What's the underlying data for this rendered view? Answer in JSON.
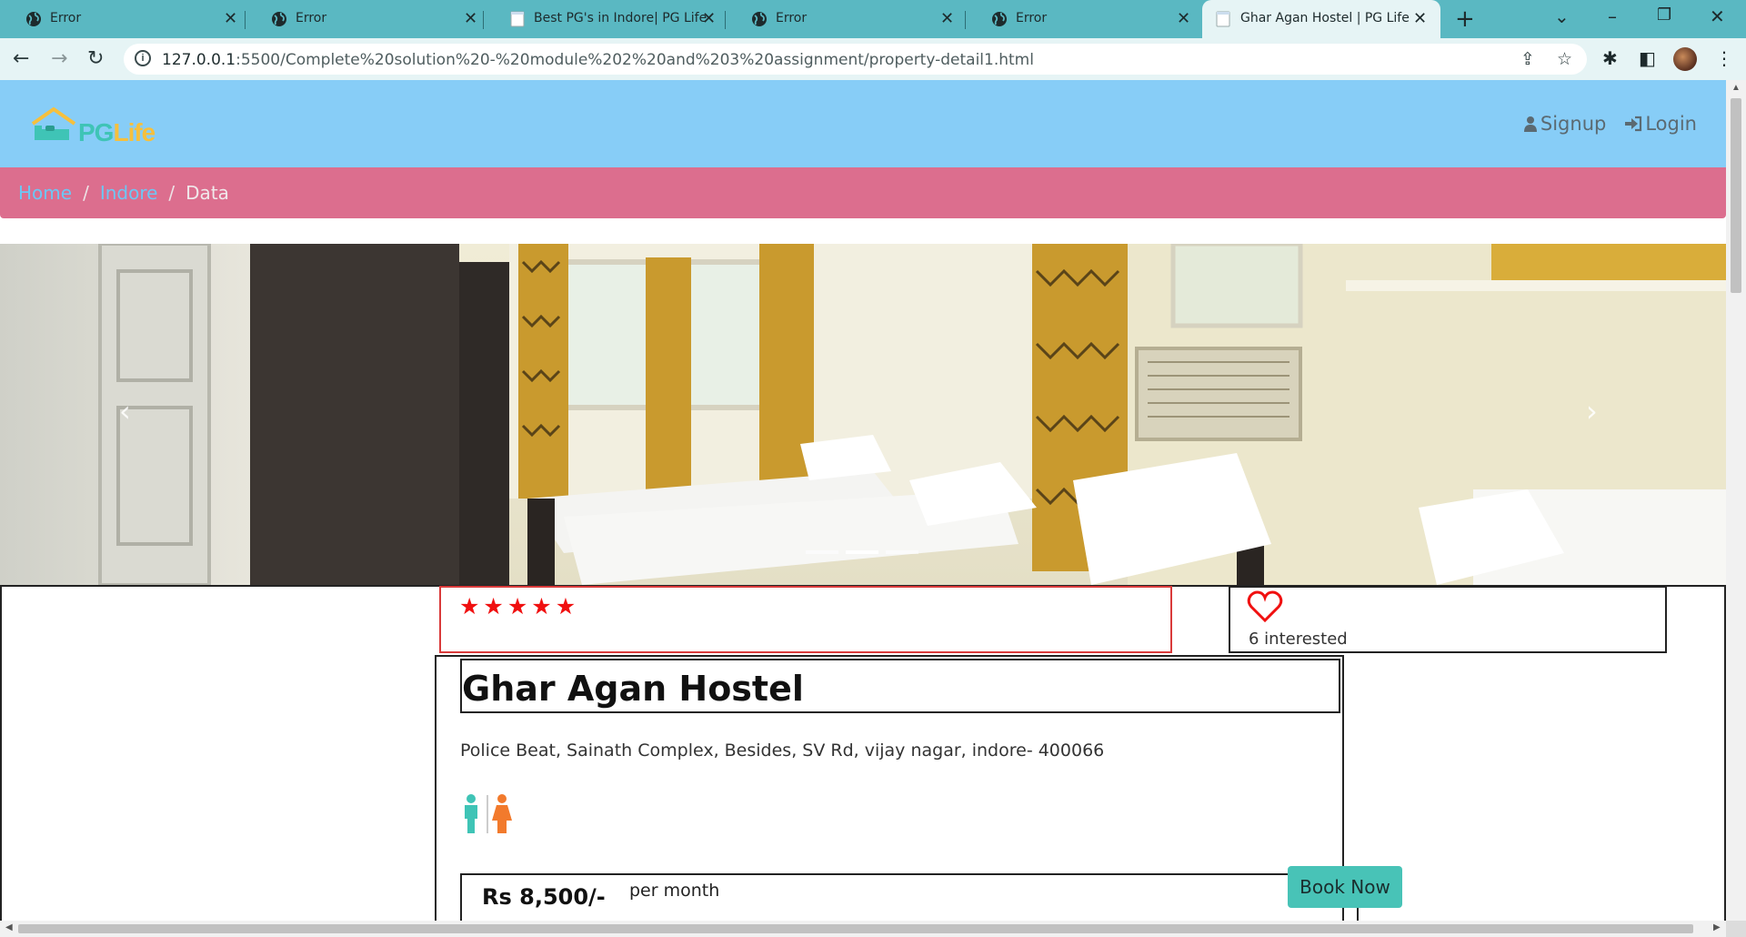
{
  "browser": {
    "tabs": [
      {
        "title": "Error",
        "icon": "globe-icon",
        "active": false
      },
      {
        "title": "Error",
        "icon": "globe-icon",
        "active": false
      },
      {
        "title": "Best PG's in Indore| PG Life",
        "icon": "page-icon",
        "active": false
      },
      {
        "title": "Error",
        "icon": "globe-icon",
        "active": false
      },
      {
        "title": "Error",
        "icon": "globe-icon",
        "active": false
      },
      {
        "title": "Ghar Agan Hostel | PG Life",
        "icon": "page-icon",
        "active": true
      }
    ],
    "url_host": "127.0.0.1",
    "url_path": ":5500/Complete%20solution%20-%20module%202%20and%203%20assignment/property-detail1.html"
  },
  "header": {
    "brand_pg": "PG",
    "brand_life": "Life",
    "signup": "Signup",
    "login": "Login"
  },
  "breadcrumb": {
    "home": "Home",
    "city": "Indore",
    "current": "Data",
    "separator": "/"
  },
  "carousel": {
    "slide_count": 3,
    "active_index": 1
  },
  "property": {
    "rating_stars": 5,
    "interested_count_text": "6 interested",
    "name": "Ghar Agan Hostel",
    "address": "Police Beat, Sainath Complex, Besides, SV Rd, vijay nagar, indore- 400066",
    "gender": "unisex",
    "rent": "Rs 8,500/-",
    "rent_unit": "per month",
    "book_button": "Book Now"
  },
  "colors": {
    "header_bg": "#87cdf7",
    "breadcrumb_bg": "#dc6e8e",
    "star": "#f01010",
    "book_button": "#48c3b7"
  }
}
